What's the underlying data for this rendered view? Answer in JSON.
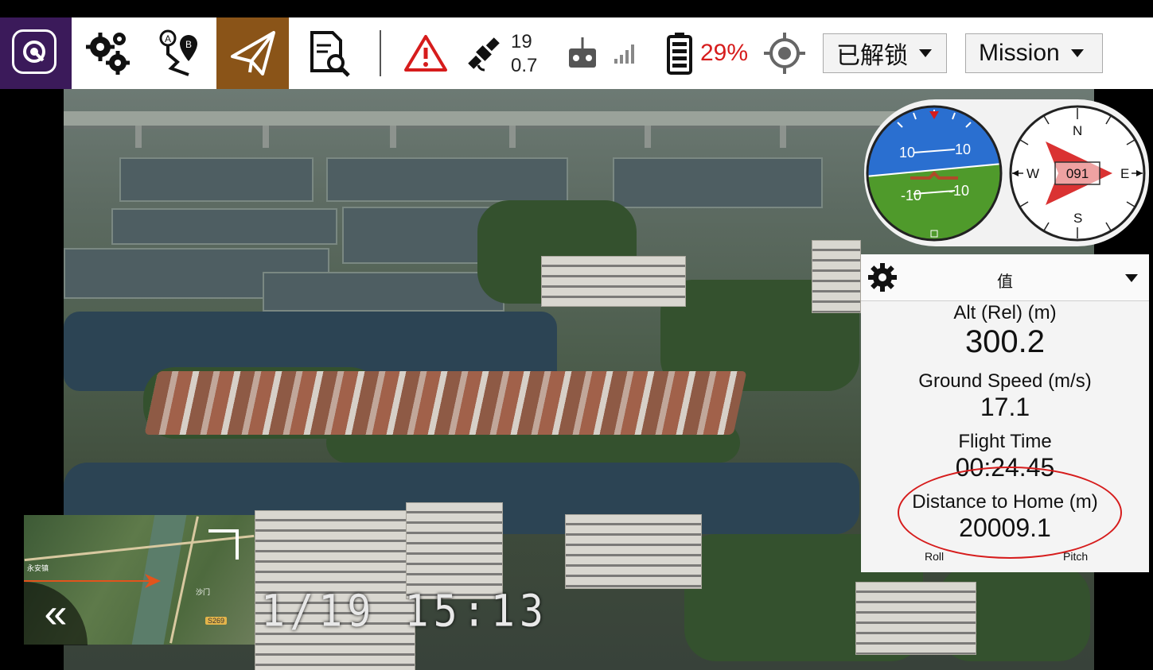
{
  "toolbar": {
    "app_logo": "qgroundcontrol-logo-icon",
    "icons": [
      "settings-gears-icon",
      "plan-route-icon",
      "fly-paper-plane-icon",
      "analyze-document-icon"
    ],
    "warning_icon": "warning-triangle-icon",
    "gps": {
      "icon": "satellite-icon",
      "satellite_count": "19",
      "hdop": "0.7"
    },
    "rc_icon": "rc-transmitter-icon",
    "signal_icon": "signal-bars-icon",
    "battery": {
      "icon": "battery-icon",
      "percent": "29%"
    },
    "position_icon": "crosshair-icon",
    "arm_status": "已解锁",
    "flight_mode": "Mission",
    "colors": {
      "active_tab": "#8a5418",
      "logo_bg": "#3b1a5a",
      "alert_red": "#d61c1c"
    }
  },
  "video": {
    "timestamp": "1/19 15:13"
  },
  "minimap": {
    "road_tag": "S269",
    "place_labels": [
      "永安镇",
      "沙门"
    ],
    "collapse_icon": "double-chevron-left-icon"
  },
  "instruments": {
    "attitude": {
      "pitch_ticks": [
        "10",
        "10",
        "-10",
        "-10"
      ]
    },
    "compass": {
      "heading": "091",
      "north": "N",
      "east": "E",
      "south": "S",
      "west": "W"
    }
  },
  "values_panel": {
    "title": "值",
    "settings_icon": "gear-icon",
    "dropdown_icon": "caret-down-icon",
    "metrics": [
      {
        "label": "Alt (Rel) (m)",
        "value": "300.2"
      },
      {
        "label": "Ground Speed (m/s)",
        "value": "17.1"
      },
      {
        "label": "Flight Time",
        "value": "00:24.45"
      },
      {
        "label": "Distance to Home (m)",
        "value": "20009.1"
      }
    ],
    "footer": {
      "left": "Roll",
      "right": "Pitch"
    }
  }
}
